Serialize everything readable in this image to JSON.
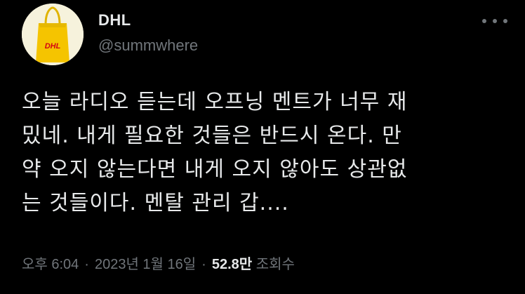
{
  "author": {
    "display_name": "DHL",
    "handle": "@summwhere",
    "avatar_icon": "yellow-tote-bag-icon",
    "avatar_brand_text": "DHL"
  },
  "more_icon": "more-horizontal-icon",
  "tweet": {
    "lines": [
      "오늘 라디오 듣는데 오프닝 멘트가 너무 재",
      "밌네. 내게 필요한 것들은 반드시 온다. 만",
      "약 오지 않는다면 내게 오지 않아도 상관없",
      "는 것들이다. 멘탈 관리 갑...."
    ]
  },
  "meta": {
    "time": "오후 6:04",
    "separator": "·",
    "date": "2023년 1월 16일",
    "views_count": "52.8만",
    "views_label": "조회수"
  },
  "colors": {
    "background": "#000000",
    "primary_text": "#e7e9ea",
    "secondary_text": "#71767b",
    "dhl_yellow": "#f5c400",
    "dhl_red": "#d40511"
  }
}
